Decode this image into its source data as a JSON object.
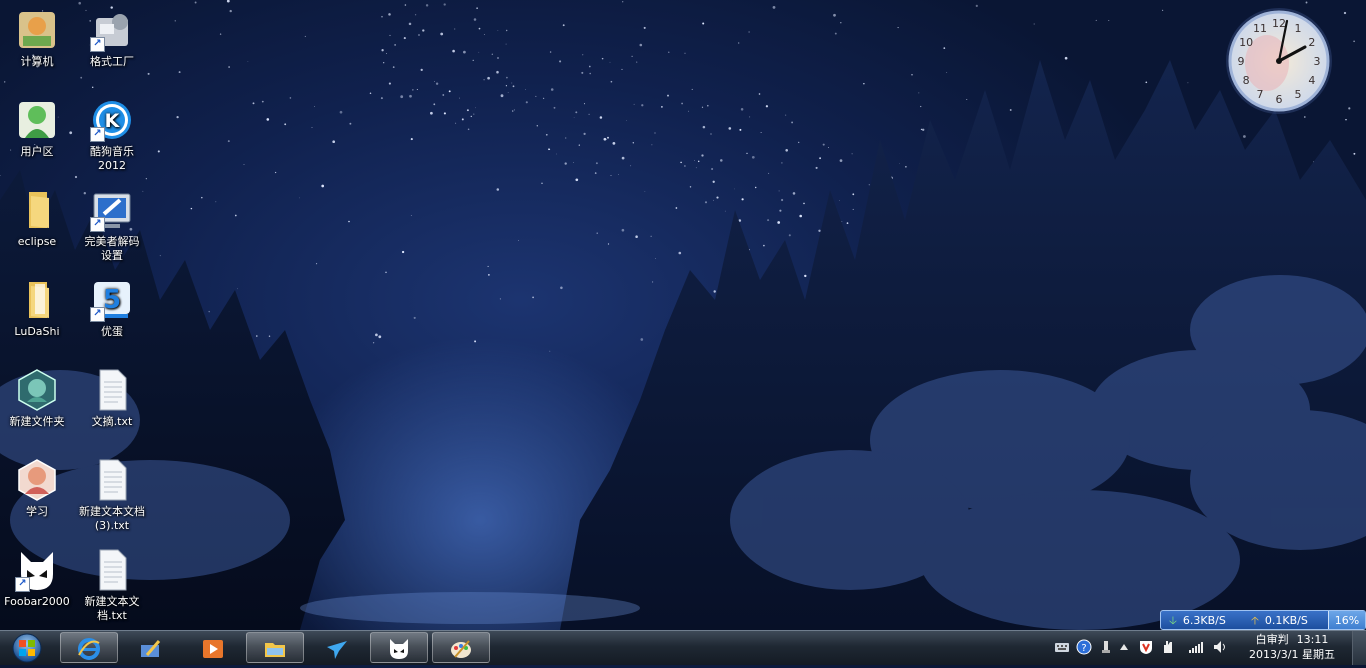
{
  "desktop_icons": [
    {
      "label": "计算机",
      "icon": "computer-icon",
      "shortcut": false
    },
    {
      "label": "格式工厂",
      "icon": "format-factory-icon",
      "shortcut": true
    },
    {
      "label": "用户区",
      "icon": "user-folder-icon",
      "shortcut": false
    },
    {
      "label": "酷狗音乐2012",
      "icon": "kugou-music-icon",
      "shortcut": true
    },
    {
      "label": "eclipse",
      "icon": "folder-icon",
      "shortcut": false
    },
    {
      "label": "完美者解码设置",
      "icon": "codec-settings-icon",
      "shortcut": true
    },
    {
      "label": "LuDaShi",
      "icon": "folder-icon",
      "shortcut": false
    },
    {
      "label": "优蛋",
      "icon": "youdan-icon",
      "shortcut": true
    },
    {
      "label": "新建文件夹",
      "icon": "anime-folder-icon",
      "shortcut": false
    },
    {
      "label": "文摘.txt",
      "icon": "text-file-icon",
      "shortcut": false
    },
    {
      "label": "学习",
      "icon": "anime-folder-icon",
      "shortcut": false
    },
    {
      "label": "新建文本文档 (3).txt",
      "icon": "text-file-icon",
      "shortcut": false
    },
    {
      "label": "Foobar2000",
      "icon": "foobar-icon",
      "shortcut": true
    },
    {
      "label": "新建文本文档.txt",
      "icon": "text-file-icon",
      "shortcut": false
    }
  ],
  "clock_gadget": {
    "numbers": [
      "12",
      "1",
      "2",
      "3",
      "4",
      "5",
      "6",
      "7",
      "8",
      "9",
      "10",
      "11"
    ],
    "time": "13:11"
  },
  "net_meter": {
    "download": "6.3KB/S",
    "upload": "0.1KB/S",
    "cpu": "16%"
  },
  "taskbar": {
    "start": "start-orb-icon",
    "buttons": [
      {
        "icon": "ie-icon",
        "pinned": true
      },
      {
        "icon": "paint-tool-icon",
        "pinned": false
      },
      {
        "icon": "media-player-icon",
        "pinned": false
      },
      {
        "icon": "explorer-folder-icon",
        "pinned": true
      },
      {
        "icon": "bird-app-icon",
        "pinned": false
      },
      {
        "icon": "foobar-icon",
        "pinned": true
      },
      {
        "icon": "paint-palette-icon",
        "pinned": true
      }
    ]
  },
  "tray": {
    "icons": [
      "keyboard-icon",
      "help-icon",
      "usb-icon",
      "show-hidden-icon",
      "antivirus-icon",
      "hand-icon",
      "network-signal-icon",
      "volume-icon"
    ],
    "user": "白审判",
    "time": "13:11",
    "date": "2013/3/1",
    "weekday": "星期五"
  },
  "colors": {
    "sky_top": "#0a1634",
    "sky_glow": "#466ebe",
    "taskbar": "#1f2833",
    "net_meter": "#2c64b8"
  }
}
